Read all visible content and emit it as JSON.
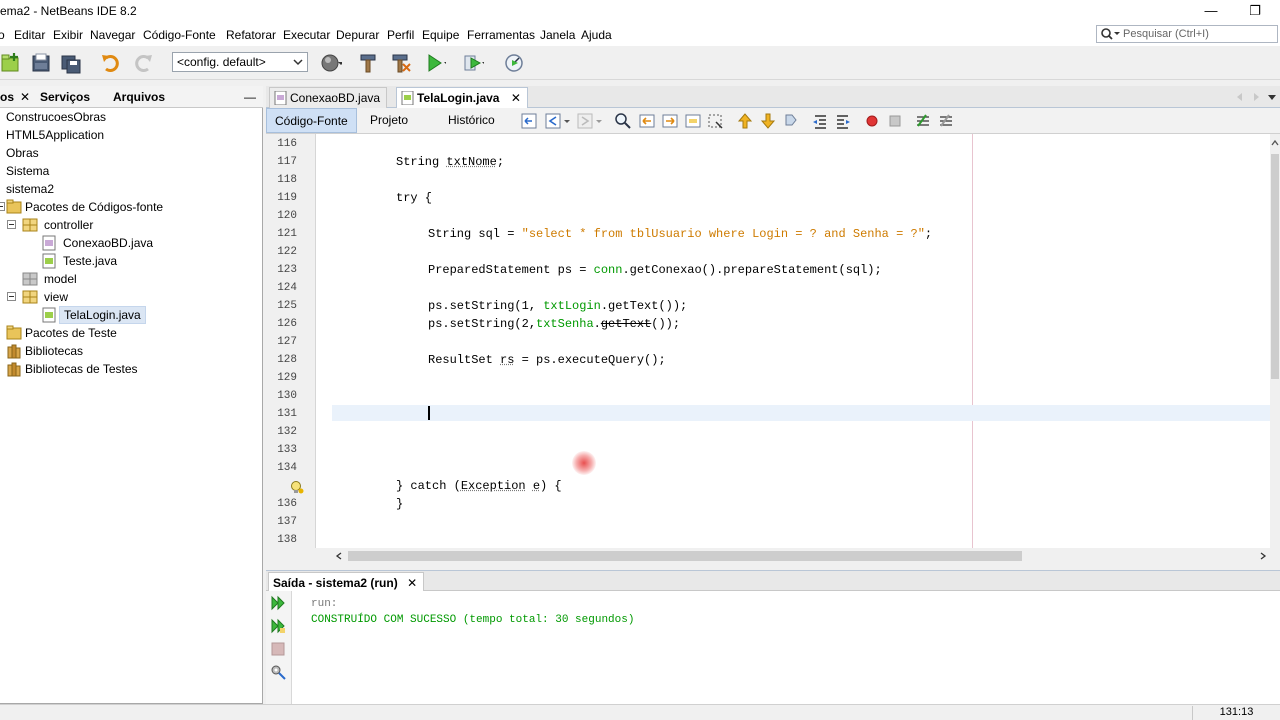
{
  "window": {
    "title": "ema2 - NetBeans IDE 8.2",
    "minimize_glyph": "—",
    "restore_glyph": "❐"
  },
  "menu": {
    "items": [
      "Arquivo",
      "Editar",
      "Exibir",
      "Navegar",
      "Código-Fonte",
      "Refatorar",
      "Executar",
      "Depurar",
      "Perfil",
      "Equipe",
      "Ferramentas",
      "Janela",
      "Ajuda"
    ],
    "visible_first": "o"
  },
  "search": {
    "placeholder": "Pesquisar (Ctrl+I)"
  },
  "toolbar": {
    "config_value": "<config. default>"
  },
  "left_panel": {
    "tabs": [
      "os",
      "Serviços",
      "Arquivos"
    ],
    "close_glyph": "✕",
    "minimize_glyph": "—",
    "tree": [
      {
        "label": "ConstrucoesObras"
      },
      {
        "label": "HTML5Application"
      },
      {
        "label": "Obras"
      },
      {
        "label": "Sistema"
      },
      {
        "label": "sistema2"
      },
      {
        "label": "Pacotes de Códigos-fonte"
      },
      {
        "label": "controller"
      },
      {
        "label": "ConexaoBD.java"
      },
      {
        "label": "Teste.java"
      },
      {
        "label": "model"
      },
      {
        "label": "view"
      },
      {
        "label": "TelaLogin.java"
      },
      {
        "label": "Pacotes de Teste"
      },
      {
        "label": "Bibliotecas"
      },
      {
        "label": "Bibliotecas de Testes"
      }
    ]
  },
  "editor": {
    "tabs": [
      {
        "label": "ConexaoBD.java",
        "active": false
      },
      {
        "label": "TelaLogin.java",
        "active": true
      }
    ],
    "close_glyph": "✕",
    "views": [
      "Código-Fonte",
      "Projeto",
      "Histórico"
    ],
    "line_numbers": [
      "116",
      "117",
      "118",
      "119",
      "120",
      "121",
      "122",
      "123",
      "124",
      "125",
      "126",
      "127",
      "128",
      "129",
      "130",
      "131",
      "132",
      "133",
      "134",
      "",
      "136",
      "137",
      "138"
    ],
    "code": {
      "l117a": "String ",
      "l117b": "txtNome",
      "l117c": ";",
      "l119": "try {",
      "l121a": "String sql = ",
      "l121b": "\"select * from tblUsuario where Login = ? and Senha = ?\"",
      "l121c": ";",
      "l123a": "PreparedStatement ps = ",
      "l123b": "conn",
      "l123c": ".getConexao().prepareStatement(sql);",
      "l125a": "ps.setString(1, ",
      "l125b": "txtLogin",
      "l125c": ".getText());",
      "l126a": "ps.setString(2,",
      "l126b": "txtSenha",
      "l126c": ".",
      "l126d": "getText",
      "l126e": "());",
      "l128a": "ResultSet ",
      "l128b": "rs",
      "l128c": " = ps.executeQuery();",
      "l135a": "} catch (",
      "l135b": "Exception",
      "l135c": " ",
      "l135d": "e",
      "l135e": ") {",
      "l136": "}"
    }
  },
  "output": {
    "tab_label": "Saída - sistema2 (run)",
    "close_glyph": "✕",
    "lines": [
      "run:",
      "CONSTRUÍDO COM SUCESSO (tempo total: 30 segundos)"
    ]
  },
  "status": {
    "position": "131:13"
  },
  "colors": {
    "string": "#ce7b00",
    "field": "#009900",
    "success_text": "#009900",
    "run_text": "#777777",
    "selection": "#dbe6f4"
  }
}
